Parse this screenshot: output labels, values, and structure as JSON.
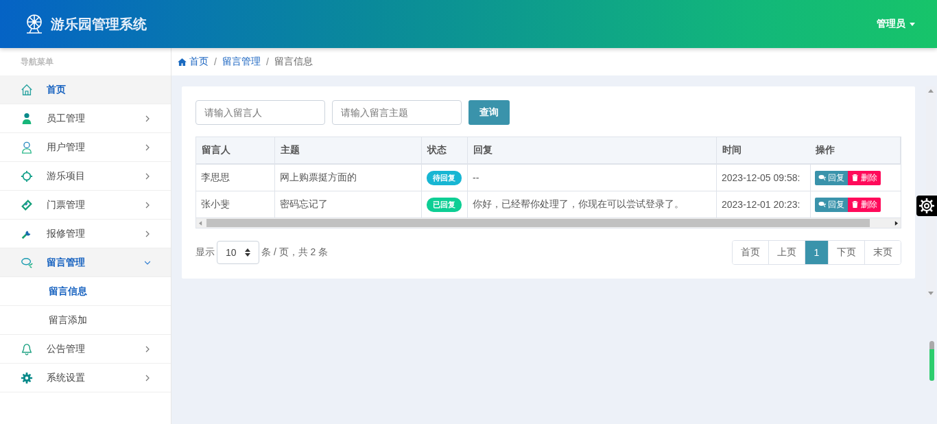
{
  "header": {
    "title": "游乐园管理系统",
    "user": "管理员"
  },
  "sidebar": {
    "heading": "导航菜单",
    "items": [
      {
        "label": "首页",
        "selected": true,
        "expanded": false,
        "has_arrow": false
      },
      {
        "label": "员工管理",
        "selected": false,
        "expanded": false,
        "has_arrow": true
      },
      {
        "label": "用户管理",
        "selected": false,
        "expanded": false,
        "has_arrow": true
      },
      {
        "label": "游乐项目",
        "selected": false,
        "expanded": false,
        "has_arrow": true
      },
      {
        "label": "门票管理",
        "selected": false,
        "expanded": false,
        "has_arrow": true
      },
      {
        "label": "报修管理",
        "selected": false,
        "expanded": false,
        "has_arrow": true
      },
      {
        "label": "留言管理",
        "selected": true,
        "expanded": true,
        "has_arrow": true,
        "children": [
          {
            "label": "留言信息",
            "selected": true
          },
          {
            "label": "留言添加",
            "selected": false
          }
        ]
      },
      {
        "label": "公告管理",
        "selected": false,
        "expanded": false,
        "has_arrow": true
      },
      {
        "label": "系统设置",
        "selected": false,
        "expanded": false,
        "has_arrow": true
      }
    ]
  },
  "breadcrumb": {
    "separator": [
      "/",
      "/"
    ],
    "items": [
      {
        "label": "首页",
        "link": true
      },
      {
        "label": "留言管理",
        "link": true
      },
      {
        "label": "留言信息",
        "link": false
      }
    ]
  },
  "search": {
    "fields": [
      {
        "placeholder": "请输入留言人"
      },
      {
        "placeholder": "请输入留言主题"
      }
    ],
    "button": "查询"
  },
  "table": {
    "columns": [
      "留言人",
      "主题",
      "状态",
      "回复",
      "时间",
      "操作"
    ],
    "rows": [
      {
        "author": "李思思",
        "subject": "网上购票挺方面的",
        "status": {
          "label": "待回复",
          "color": "#17b6d3"
        },
        "reply": "--",
        "time": "2023-12-05 09:58:",
        "actions": [
          "回复",
          "删除"
        ]
      },
      {
        "author": "张小斐",
        "subject": "密码忘记了",
        "status": {
          "label": "已回复",
          "color": "#0dce94"
        },
        "reply": "你好，已经帮你处理了，你现在可以尝试登录了。",
        "time": "2023-12-01 20:23:",
        "actions": [
          "回复",
          "删除"
        ]
      }
    ]
  },
  "pager": {
    "show": "显示",
    "page_size": "10",
    "summary": "条 / 页，共 2 条",
    "pages": [
      {
        "label": "首页",
        "selected": false
      },
      {
        "label": "上页",
        "selected": false
      },
      {
        "label": "1",
        "selected": true
      },
      {
        "label": "下页",
        "selected": false
      },
      {
        "label": "末页",
        "selected": false
      }
    ]
  }
}
